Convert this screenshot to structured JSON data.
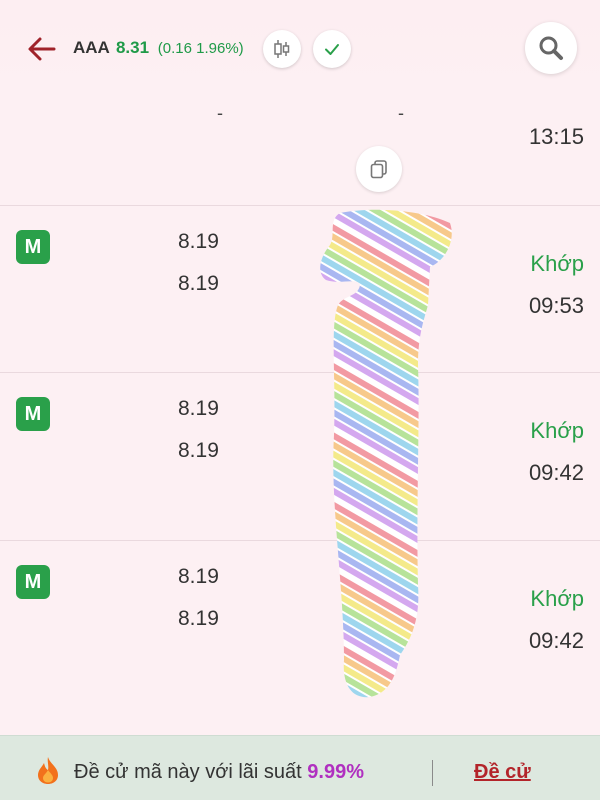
{
  "header": {
    "symbol": "AAA",
    "price": "8.31",
    "change": "(0.16 1.96%)"
  },
  "partial_row": {
    "dash_a": "-",
    "dash_b": "-",
    "time": "13:15"
  },
  "orders": [
    {
      "badge": "M",
      "value1": "8.19",
      "value2": "8.19",
      "status": "Khớp",
      "time": "09:53"
    },
    {
      "badge": "M",
      "value1": "8.19",
      "value2": "8.19",
      "status": "Khớp",
      "time": "09:42"
    },
    {
      "badge": "M",
      "value1": "8.19",
      "value2": "8.19",
      "status": "Khớp",
      "time": "09:42"
    }
  ],
  "footer": {
    "promo_text": "Đề cử mã này với lãi suất",
    "rate": "9.99%",
    "nominate": "Đề cử"
  },
  "colors": {
    "up": "#1f9a48",
    "badge": "#2aa04a",
    "accent_red": "#b3242a",
    "rate": "#b030c0"
  },
  "icons": [
    "back-arrow-icon",
    "candlestick-icon",
    "check-icon",
    "search-icon",
    "copy-icon",
    "fire-icon"
  ]
}
